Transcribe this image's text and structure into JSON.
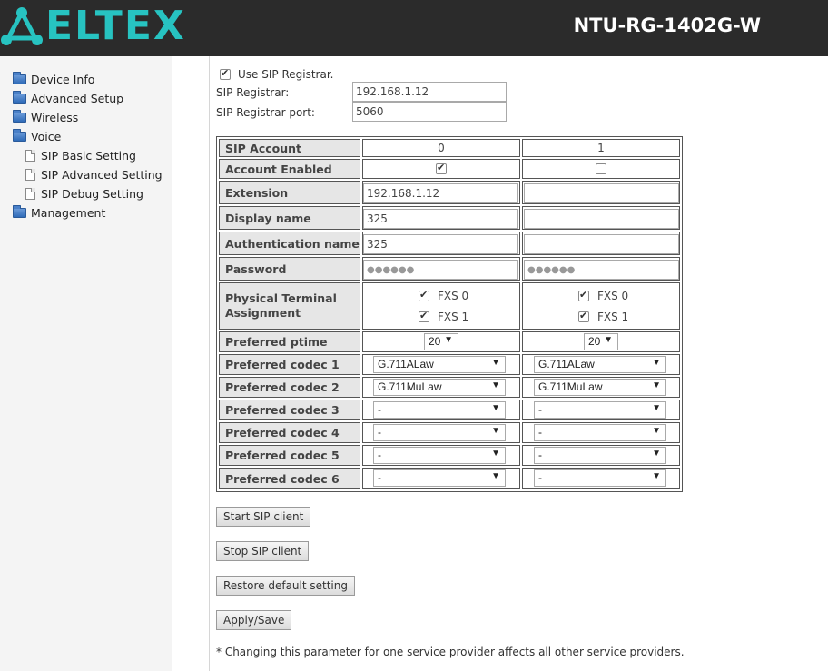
{
  "header": {
    "logo_text": "ELTEX",
    "model": "NTU-RG-1402G-W",
    "colors": {
      "background": "#2b2b2b",
      "logo": "#27c3c1"
    }
  },
  "sidebar": {
    "items": [
      {
        "label": "Device Info",
        "icon": "folder-icon"
      },
      {
        "label": "Advanced Setup",
        "icon": "folder-icon"
      },
      {
        "label": "Wireless",
        "icon": "folder-icon"
      },
      {
        "label": "Voice",
        "icon": "folder-open-icon"
      },
      {
        "label": "SIP Basic Setting",
        "icon": "page-icon"
      },
      {
        "label": "SIP Advanced Setting",
        "icon": "page-icon"
      },
      {
        "label": "SIP Debug Setting",
        "icon": "page-icon"
      },
      {
        "label": "Management",
        "icon": "folder-icon"
      }
    ]
  },
  "registrar": {
    "use_label": "Use SIP Registrar.",
    "use_checked": true,
    "address_label": "SIP Registrar:",
    "address_value": "192.168.1.12",
    "port_label": "SIP Registrar port:",
    "port_value": "5060"
  },
  "table": {
    "rows": {
      "account": "SIP Account",
      "enabled": "Account Enabled",
      "extension": "Extension",
      "display_name": "Display name",
      "auth_name": "Authentication name",
      "password": "Password",
      "terminal": "Physical Terminal Assignment",
      "ptime": "Preferred ptime",
      "codec1": "Preferred codec 1",
      "codec2": "Preferred codec 2",
      "codec3": "Preferred codec 3",
      "codec4": "Preferred codec 4",
      "codec5": "Preferred codec 5",
      "codec6": "Preferred codec 6"
    },
    "accounts": [
      {
        "id": "0",
        "enabled": true,
        "extension": "192.168.1.12",
        "display_name": "325",
        "auth_name": "325",
        "password": "●●●●●●",
        "fxs0_label": "FXS 0",
        "fxs0": true,
        "fxs1_label": "FXS 1",
        "fxs1": true,
        "ptime": "20",
        "codecs": [
          "G.711ALaw",
          "G.711MuLaw",
          "-",
          "-",
          "-",
          "-"
        ]
      },
      {
        "id": "1",
        "enabled": false,
        "extension": "",
        "display_name": "",
        "auth_name": "",
        "password": "●●●●●●",
        "fxs0_label": "FXS 0",
        "fxs0": true,
        "fxs1_label": "FXS 1",
        "fxs1": true,
        "ptime": "20",
        "codecs": [
          "G.711ALaw",
          "G.711MuLaw",
          "-",
          "-",
          "-",
          "-"
        ]
      }
    ]
  },
  "buttons": {
    "start": "Start SIP client",
    "stop": "Stop SIP client",
    "restore": "Restore default setting",
    "apply": "Apply/Save"
  },
  "note": "* Changing this parameter for one service provider affects all other service providers."
}
